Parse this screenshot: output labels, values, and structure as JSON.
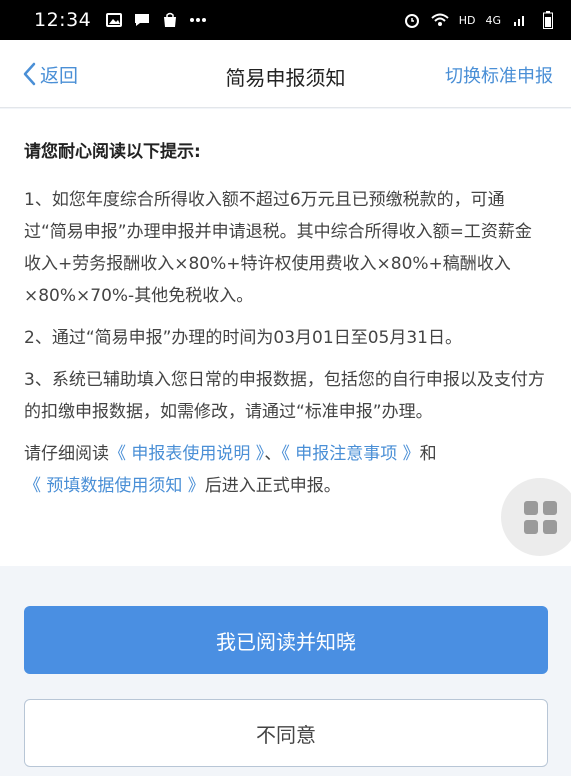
{
  "status_bar": {
    "time": "12:34",
    "network": "HD",
    "signal": "4G"
  },
  "nav": {
    "back_label": "返回",
    "title": "简易申报须知",
    "switch_label": "切换标准申报"
  },
  "notice": {
    "heading": "请您耐心阅读以下提示:",
    "items": [
      "1、如您年度综合所得收入额不超过6万元且已预缴税款的，可通过“简易申报”办理申报并申请退税。其中综合所得收入额=工资薪金收入+劳务报酬收入×80%+特许权使用费收入×80%+稿酬收入×80%×70%-其他免税收入。",
      "2、通过“简易申报”办理的时间为03月01日至05月31日。",
      "3、系统已辅助填入您日常的申报数据，包括您的自行申报以及支付方的扣缴申报数据，如需修改，请通过“标准申报”办理。"
    ],
    "read_prefix": "请仔细阅读",
    "link_1": "《 申报表使用说明 》",
    "sep_1": "、",
    "link_2": "《 申报注意事项 》",
    "sep_2": "和",
    "link_3": "《 预填数据使用须知 》",
    "read_suffix": "后进入正式申报。"
  },
  "actions": {
    "agree_label": "我已阅读并知晓",
    "disagree_label": "不同意"
  },
  "icons": {
    "status_left": [
      "image-icon",
      "message-icon",
      "bag-icon",
      "more-dots-icon"
    ],
    "status_right": [
      "alarm-icon",
      "wifi-icon",
      "signal-icon",
      "battery-icon"
    ],
    "float": "grid-menu-icon"
  },
  "colors": {
    "accent": "#4a8fd6",
    "primary_button": "#4a8fe2",
    "status_bar": "#000000"
  }
}
